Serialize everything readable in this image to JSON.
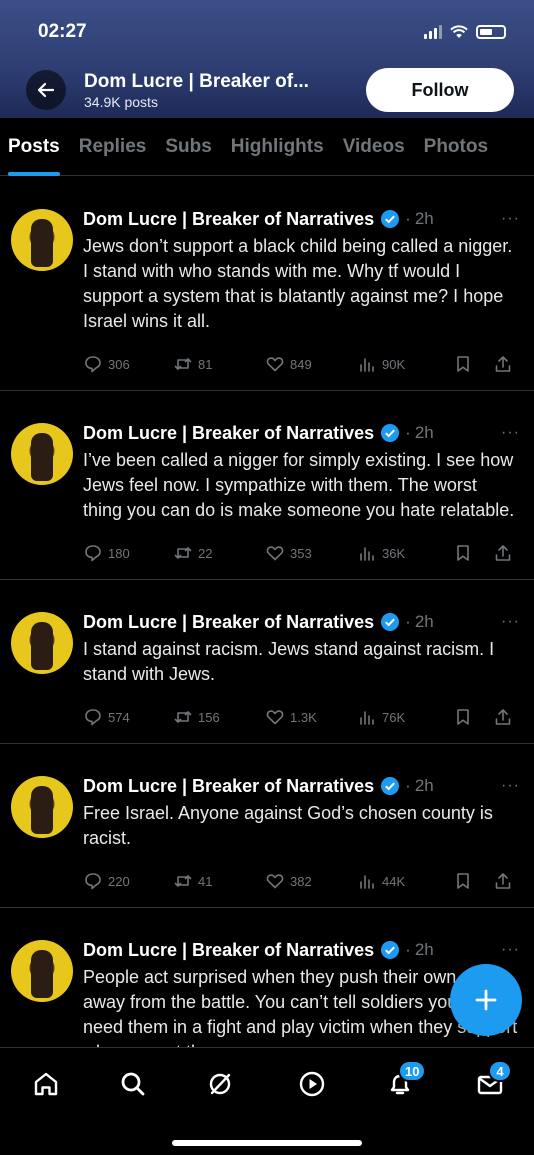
{
  "status_bar": {
    "time": "02:27"
  },
  "header": {
    "name": "Dom Lucre | Breaker of...",
    "post_count": "34.9K posts",
    "follow_label": "Follow"
  },
  "tabs": [
    "Posts",
    "Replies",
    "Subs",
    "Highlights",
    "Videos",
    "Photos"
  ],
  "tweets": [
    {
      "author": "Dom Lucre | Breaker of Narratives",
      "time": "2h",
      "text": "Jews don’t support a black child being called a nigger. I stand with who stands with me. Why tf would I support a system that is blatantly against me? I hope Israel wins it all.",
      "replies": "306",
      "reposts": "81",
      "likes": "849",
      "views": "90K"
    },
    {
      "author": "Dom Lucre | Breaker of Narratives",
      "time": "2h",
      "text": "I’ve been called a nigger for simply existing. I see how Jews feel now. I sympathize with them. The worst thing you can do is make someone you hate relatable.",
      "replies": "180",
      "reposts": "22",
      "likes": "353",
      "views": "36K"
    },
    {
      "author": "Dom Lucre | Breaker of Narratives",
      "time": "2h",
      "text": "I stand against racism. Jews stand against racism. I stand with Jews.",
      "replies": "574",
      "reposts": "156",
      "likes": "1.3K",
      "views": "76K"
    },
    {
      "author": "Dom Lucre | Breaker of Narratives",
      "time": "2h",
      "text": "Free Israel. Anyone against God’s chosen county is racist.",
      "replies": "220",
      "reposts": "41",
      "likes": "382",
      "views": "44K"
    },
    {
      "author": "Dom Lucre | Breaker of Narratives",
      "time": "2h",
      "text": "People act surprised when they push their own allies away from the battle. You can’t tell soldiers you don’t need them in a fight and play victim when they support who support them."
    }
  ],
  "nav": {
    "notifications_badge": "10",
    "messages_badge": "4"
  },
  "colors": {
    "accent": "#1d9bf0",
    "background": "#000000",
    "muted": "#71767b"
  }
}
